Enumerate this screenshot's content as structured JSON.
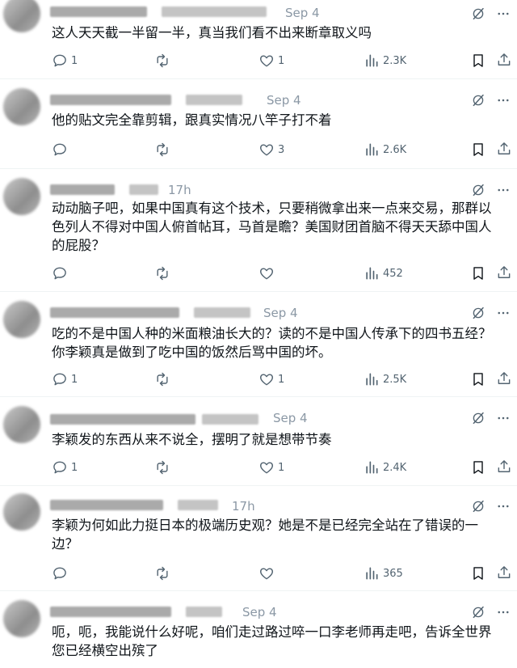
{
  "posts": [
    {
      "date": "Sep 4",
      "text": "这人天天截一半留一半，真当我们看不出来断章取义吗",
      "replies": "1",
      "reposts": "",
      "likes": "1",
      "views": "2.3K"
    },
    {
      "date": "Sep 4",
      "text": "他的贴文完全靠剪辑，跟真实情况八竿子打不着",
      "replies": "",
      "reposts": "",
      "likes": "3",
      "views": "2.6K"
    },
    {
      "date": "17h",
      "text": "动动脑子吧，如果中国真有这个技术，只要稍微拿出来一点来交易，那群以\n色列人不得对中国人俯首帖耳，马首是瞻？美国财团首脑不得天天舔中国人\n的屁股？",
      "replies": "",
      "reposts": "",
      "likes": "",
      "views": "452"
    },
    {
      "date": "Sep 4",
      "text": "吃的不是中国人种的米面粮油长大的？读的不是中国人传承下的四书五经？\n你李颖真是做到了吃中国的饭然后骂中国的坏。",
      "replies": "1",
      "reposts": "",
      "likes": "1",
      "views": "2.5K"
    },
    {
      "date": "Sep 4",
      "text": "李颖发的东西从来不说全，摆明了就是想带节奏",
      "replies": "1",
      "reposts": "",
      "likes": "1",
      "views": "2.4K"
    },
    {
      "date": "17h",
      "text": "李颖为何如此力挺日本的极端历史观？她是不是已经完全站在了错误的一\n边？",
      "replies": "",
      "reposts": "",
      "likes": "",
      "views": "365"
    },
    {
      "date": "Sep 4",
      "text": "呃，呃，我能说什么好呢，咱们走过路过啐一口李老师再走吧，告诉全世界\n您已经横空出殡了",
      "replies": "",
      "reposts": "",
      "likes": "",
      "views": ""
    }
  ],
  "icons": {
    "reply": "speech-bubble-icon",
    "repost": "repost-arrows-icon",
    "like": "heart-icon",
    "views": "bar-chart-icon",
    "bookmark": "bookmark-icon",
    "share": "share-upload-icon",
    "grok": "grok-slash-icon",
    "more": "more-dots-icon"
  },
  "colors": {
    "text": "#0f1419",
    "muted": "#536471",
    "date": "#8b98a5",
    "divider": "#eff3f4"
  }
}
